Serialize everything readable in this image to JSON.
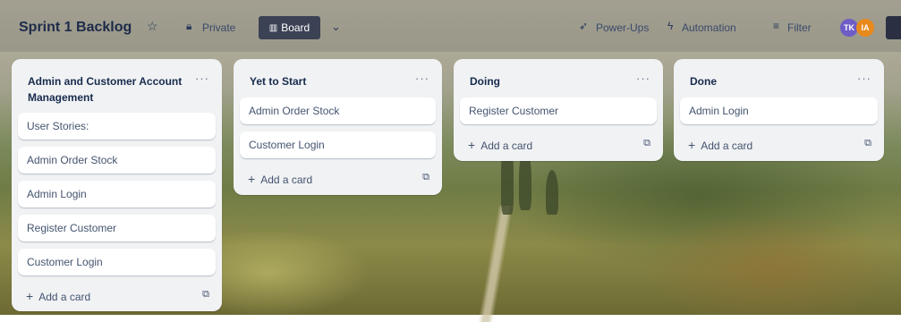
{
  "header": {
    "title": "Sprint 1 Backlog",
    "visibility": "Private",
    "view": "Board",
    "power_ups": "Power-Ups",
    "automation": "Automation",
    "filter": "Filter",
    "avatars": [
      {
        "initials": "TK",
        "color": "#6e5dc6"
      },
      {
        "initials": "IA",
        "color": "#e8891c"
      }
    ]
  },
  "lists": [
    {
      "title": "Admin and Customer Account Management",
      "cards": [
        "User Stories:",
        "Admin Order Stock",
        "Admin Login",
        "Register Customer",
        "Customer Login"
      ],
      "add_card": "Add a card"
    },
    {
      "title": "Yet to Start",
      "cards": [
        "Admin Order Stock",
        "Customer Login"
      ],
      "add_card": "Add a card"
    },
    {
      "title": "Doing",
      "cards": [
        "Register Customer"
      ],
      "add_card": "Add a card"
    },
    {
      "title": "Done",
      "cards": [
        "Admin Login"
      ],
      "add_card": "Add a card"
    }
  ]
}
